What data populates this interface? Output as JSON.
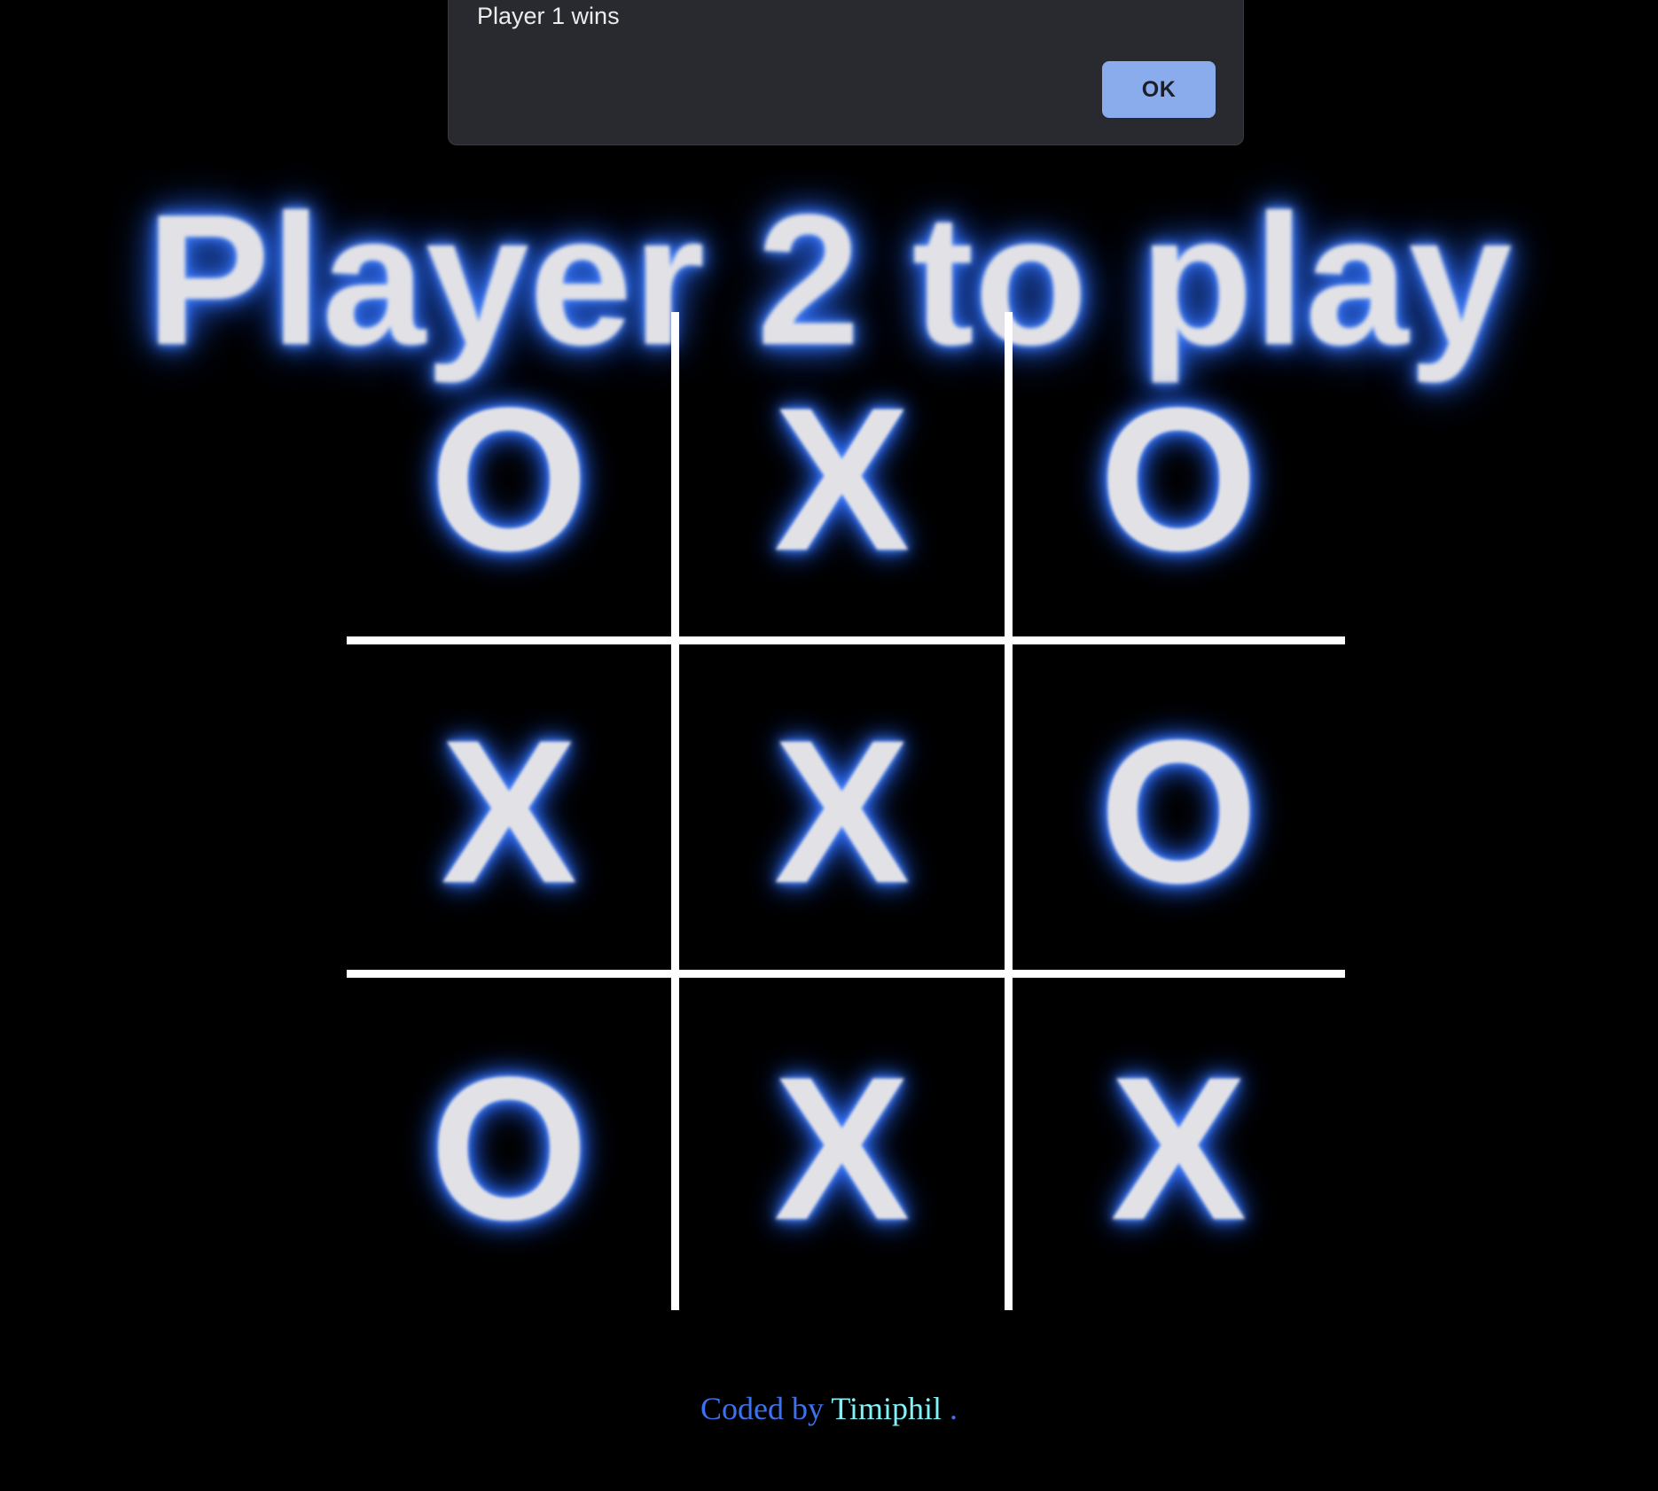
{
  "status": {
    "title": "Player 2 to play"
  },
  "board": {
    "cells": [
      [
        "O",
        "X",
        "O"
      ],
      [
        "X",
        "X",
        "O"
      ],
      [
        "O",
        "X",
        "X"
      ]
    ]
  },
  "footer": {
    "prefix": "Coded by",
    "author": "Timiphil",
    "suffix": "."
  },
  "dialog": {
    "message": "Player 1 wins",
    "ok_label": "OK"
  },
  "colors": {
    "background": "#000000",
    "glow": "#3a78ff",
    "mark_text": "#e2e2e6",
    "grid_lines": "#ffffff",
    "footer_text": "#3c72f0",
    "author_link": "#7ff3f8",
    "dialog_bg": "#292a2f",
    "ok_button": "#8aacec"
  }
}
